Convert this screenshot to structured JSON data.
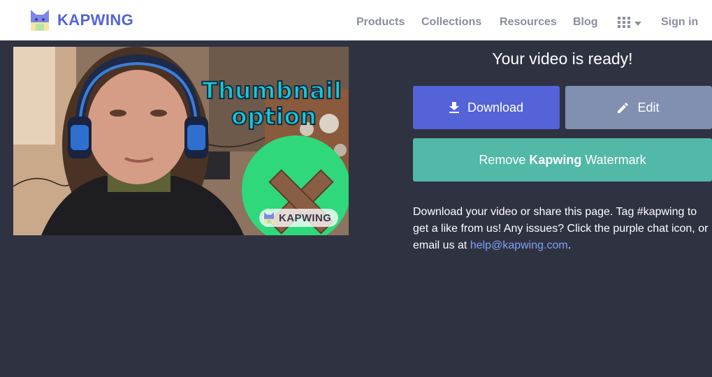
{
  "header": {
    "brand": "KAPWING",
    "nav": [
      "Products",
      "Collections",
      "Resources",
      "Blog"
    ],
    "sign_in": "Sign in"
  },
  "video": {
    "overlay_line1": "Thumbnail",
    "overlay_line2": "option",
    "watermark_text": "KAPWING"
  },
  "panel": {
    "title": "Your video is ready!",
    "download_label": "Download",
    "edit_label": "Edit",
    "watermark_prefix": "Remove",
    "watermark_brand": "Kapwing",
    "watermark_suffix": "Watermark",
    "info_text": "Download your video or share this page. Tag #kapwing to get a like from us! Any issues? Click the purple chat icon, or email us at",
    "email": "help@kapwing.com",
    "info_end": "."
  },
  "colors": {
    "brand": "#5364d9",
    "download": "#5463d8",
    "edit": "#818fb0",
    "watermark": "#52b8a7",
    "background": "#2f3241",
    "link": "#7fa2f5"
  },
  "icons": {
    "download": "download-arrow-icon",
    "edit": "pencil-icon",
    "grid": "apps-grid-icon",
    "caret": "caret-down-icon",
    "logo": "kapwing-cat-logo-icon"
  }
}
